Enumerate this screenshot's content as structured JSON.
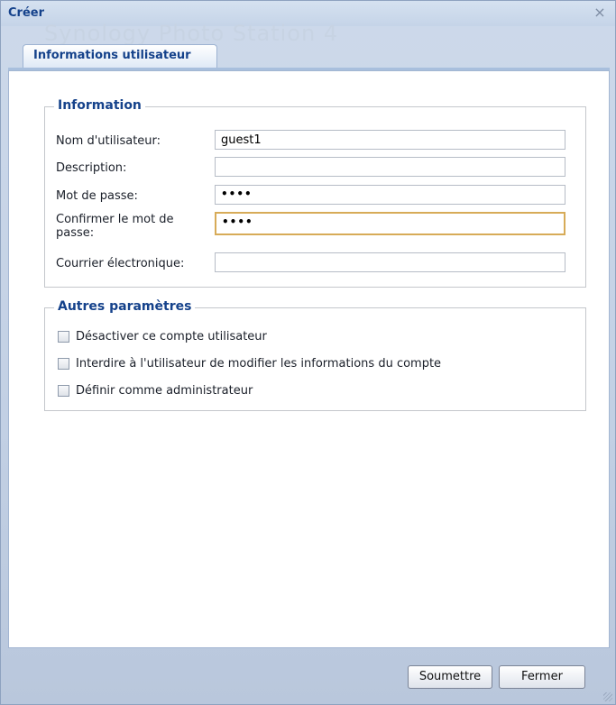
{
  "window": {
    "title": "Créer",
    "background_text": "Synology Photo Station 4",
    "close_glyph": "×"
  },
  "tabs": [
    {
      "label": "Informations utilisateur",
      "active": true
    }
  ],
  "information": {
    "legend": "Information",
    "fields": [
      {
        "label": "Nom d'utilisateur:",
        "value": "guest1",
        "type": "text"
      },
      {
        "label": "Description:",
        "value": "",
        "type": "text"
      },
      {
        "label": "Mot de passe:",
        "value": "••••",
        "type": "password"
      },
      {
        "label": "Confirmer le mot de passe:",
        "value": "••••",
        "type": "password",
        "focused": true
      },
      {
        "label": "Courrier électronique:",
        "value": "",
        "type": "text"
      }
    ]
  },
  "other": {
    "legend": "Autres paramètres",
    "checkboxes": [
      {
        "label": "Désactiver ce compte utilisateur",
        "checked": false
      },
      {
        "label": "Interdire à l'utilisateur de modifier les informations du compte",
        "checked": false
      },
      {
        "label": "Définir comme administrateur",
        "checked": false
      }
    ]
  },
  "buttons": {
    "submit": "Soumettre",
    "close": "Fermer"
  },
  "colors": {
    "title": "#15428b",
    "focus_border": "#d7ab58",
    "panel_border": "#a3b6d2"
  }
}
